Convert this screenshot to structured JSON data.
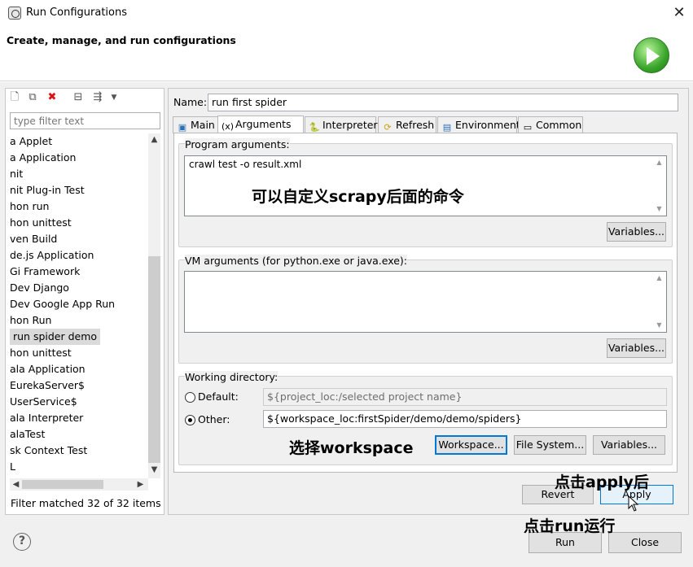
{
  "window": {
    "title": "Run Configurations",
    "close_glyph": "✕"
  },
  "banner": {
    "heading": "Create, manage, and run configurations",
    "icon": "run-icon"
  },
  "left": {
    "filter_placeholder": "type filter text",
    "items": [
      "a Applet",
      "a Application",
      "nit",
      "nit Plug-in Test",
      "hon run",
      "hon unittest",
      "ven Build",
      "de.js Application",
      "Gi Framework",
      "Dev Django",
      "Dev Google App Run",
      "hon Run",
      "run spider demo",
      "hon unittest",
      "ala Application",
      "EurekaServer$",
      "UserService$",
      "ala Interpreter",
      "alaTest",
      "sk Context Test",
      "L"
    ],
    "selected_index": 12,
    "status": "Filter matched 32 of 32 items"
  },
  "config": {
    "name_label": "Name:",
    "name_value": "run first spider",
    "tabs": [
      "Main",
      "Arguments",
      "Interpreter",
      "Refresh",
      "Environment",
      "Common"
    ],
    "active_tab": "Arguments",
    "program_args_label": "Program arguments:",
    "program_args_value": "crawl test -o result.xml",
    "vm_args_label": "VM arguments (for python.exe or java.exe):",
    "vm_args_value": "",
    "variables_label": "Variables...",
    "working_dir_label": "Working directory:",
    "default_label": "Default:",
    "default_value": "${project_loc:/selected project name}",
    "other_label": "Other:",
    "other_value": "${workspace_loc:firstSpider/demo/demo/spiders}",
    "workspace_btn": "Workspace...",
    "filesystem_btn": "File System...",
    "revert_btn": "Revert",
    "apply_btn": "Apply"
  },
  "footer": {
    "run_btn": "Run",
    "close_btn": "Close",
    "help_glyph": "?"
  },
  "annotations": {
    "custom_cmd": "可以自定义scrapy后面的命令",
    "select_ws": "选择workspace",
    "click_apply": "点击apply后",
    "click_run": "点击run运行"
  }
}
